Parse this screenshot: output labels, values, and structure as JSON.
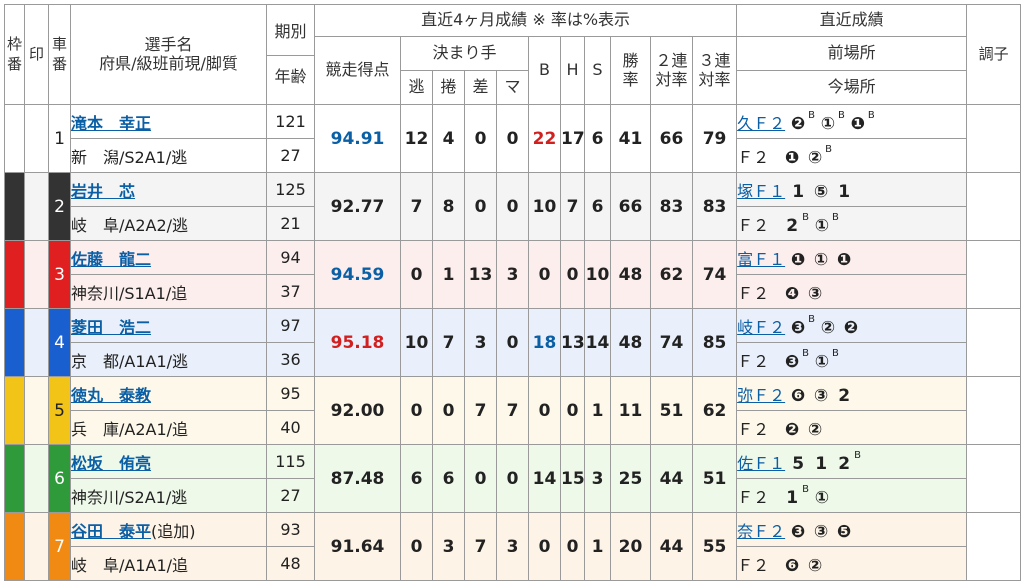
{
  "header": {
    "waku": "枠番",
    "mark": "印",
    "car": "車番",
    "name1": "選手名",
    "name2": "府県/級班前現/脚質",
    "period": "期別",
    "age": "年齢",
    "recent4": "直近4ヶ月成績 ※ 率は%表示",
    "score": "競走得点",
    "kimari": "決まり手",
    "nige": "逃",
    "makuri": "捲",
    "sashi": "差",
    "mark_k": "マ",
    "b": "B",
    "h": "H",
    "s": "S",
    "win1": "勝",
    "win2": "率",
    "ren2a": "２連",
    "ren2b": "対率",
    "ren3a": "３連",
    "ren3b": "対率",
    "recent": "直近成績",
    "prev": "前場所",
    "cur": "今場所",
    "tone": "調子"
  },
  "riders": [
    {
      "waku_color": "#ffffff",
      "waku_text": "#222222",
      "car": "1",
      "name": "滝本　幸正",
      "extra": "",
      "pref": "新　潟/S2A1/逃",
      "period": "121",
      "age": "27",
      "score": "94.91",
      "nige": "12",
      "makuri": "4",
      "sashi": "0",
      "mark": "0",
      "b": "22",
      "h": "17",
      "s": "6",
      "win": "41",
      "ren2": "66",
      "ren3": "79",
      "prev_venue": "久Ｆ２",
      "prev_res": [
        "❷",
        "①",
        "❶"
      ],
      "prev_sup": [
        "B",
        "B",
        "B"
      ],
      "cur_label": "Ｆ２",
      "cur_res": [
        "❶",
        "②"
      ],
      "cur_sup": [
        "",
        "B"
      ]
    },
    {
      "waku_color": "#333333",
      "waku_text": "#ffffff",
      "car": "2",
      "name": "岩井　芯",
      "extra": "",
      "pref": "岐　阜/A2A2/逃",
      "period": "125",
      "age": "21",
      "score": "92.77",
      "nige": "7",
      "makuri": "8",
      "sashi": "0",
      "mark": "0",
      "b": "10",
      "h": "7",
      "s": "6",
      "win": "66",
      "ren2": "83",
      "ren3": "83",
      "prev_venue": "塚Ｆ１",
      "prev_res": [
        "1",
        "⑤",
        "1"
      ],
      "prev_sup": [
        "",
        "",
        ""
      ],
      "cur_label": "Ｆ２",
      "cur_res": [
        "2",
        "①"
      ],
      "cur_sup": [
        "B",
        "B"
      ]
    },
    {
      "waku_color": "#e02020",
      "waku_text": "#ffffff",
      "car": "3",
      "name": "佐藤　龍二",
      "extra": "",
      "pref": "神奈川/S1A1/追",
      "period": "94",
      "age": "37",
      "score": "94.59",
      "nige": "0",
      "makuri": "1",
      "sashi": "13",
      "mark": "3",
      "b": "0",
      "h": "0",
      "s": "10",
      "win": "48",
      "ren2": "62",
      "ren3": "74",
      "prev_venue": "富Ｆ１",
      "prev_res": [
        "❶",
        "①",
        "❶"
      ],
      "prev_sup": [
        "",
        "",
        ""
      ],
      "cur_label": "Ｆ２",
      "cur_res": [
        "❹",
        "③"
      ],
      "cur_sup": [
        "",
        ""
      ]
    },
    {
      "waku_color": "#1a5fd0",
      "waku_text": "#ffffff",
      "car": "4",
      "name": "菱田　浩二",
      "extra": "",
      "pref": "京　都/A1A1/逃",
      "period": "97",
      "age": "36",
      "score": "95.18",
      "nige": "10",
      "makuri": "7",
      "sashi": "3",
      "mark": "0",
      "b": "18",
      "h": "13",
      "s": "14",
      "win": "48",
      "ren2": "74",
      "ren3": "85",
      "prev_venue": "岐Ｆ２",
      "prev_res": [
        "❸",
        "②",
        "❷"
      ],
      "prev_sup": [
        "B",
        "",
        ""
      ],
      "cur_label": "Ｆ２",
      "cur_res": [
        "❸",
        "①"
      ],
      "cur_sup": [
        "B",
        "B"
      ]
    },
    {
      "waku_color": "#f2c418",
      "waku_text": "#222222",
      "car": "5",
      "name": "徳丸　泰教",
      "extra": "",
      "pref": "兵　庫/A2A1/追",
      "period": "95",
      "age": "40",
      "score": "92.00",
      "nige": "0",
      "makuri": "0",
      "sashi": "7",
      "mark": "7",
      "b": "0",
      "h": "0",
      "s": "1",
      "win": "11",
      "ren2": "51",
      "ren3": "62",
      "prev_venue": "弥Ｆ２",
      "prev_res": [
        "❻",
        "③",
        "2"
      ],
      "prev_sup": [
        "",
        "",
        ""
      ],
      "cur_label": "Ｆ２",
      "cur_res": [
        "❷",
        "②"
      ],
      "cur_sup": [
        "",
        ""
      ]
    },
    {
      "waku_color": "#2e9a3a",
      "waku_text": "#ffffff",
      "car": "6",
      "name": "松坂　侑亮",
      "extra": "",
      "pref": "神奈川/S2A1/逃",
      "period": "115",
      "age": "27",
      "score": "87.48",
      "nige": "6",
      "makuri": "6",
      "sashi": "0",
      "mark": "0",
      "b": "14",
      "h": "15",
      "s": "3",
      "win": "25",
      "ren2": "44",
      "ren3": "51",
      "prev_venue": "佐Ｆ１",
      "prev_res": [
        "5",
        "1",
        "2"
      ],
      "prev_sup": [
        "",
        "",
        "B"
      ],
      "cur_label": "Ｆ２",
      "cur_res": [
        "1",
        "①"
      ],
      "cur_sup": [
        "B",
        ""
      ]
    },
    {
      "waku_color": "#f08a12",
      "waku_text": "#ffffff",
      "car": "7",
      "name": "谷田　泰平",
      "extra": "(追加)",
      "pref": "岐　阜/A1A1/追",
      "period": "93",
      "age": "48",
      "score": "91.64",
      "nige": "0",
      "makuri": "3",
      "sashi": "7",
      "mark": "3",
      "b": "0",
      "h": "0",
      "s": "1",
      "win": "20",
      "ren2": "44",
      "ren3": "55",
      "prev_venue": "奈Ｆ２",
      "prev_res": [
        "❸",
        "③",
        "❺"
      ],
      "prev_sup": [
        "",
        "",
        ""
      ],
      "cur_label": "Ｆ２",
      "cur_res": [
        "❻",
        "②"
      ],
      "cur_sup": [
        "",
        ""
      ]
    }
  ]
}
